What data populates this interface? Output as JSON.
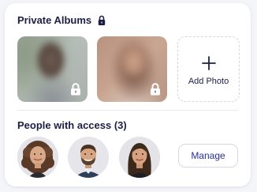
{
  "private_albums": {
    "title": "Private Albums",
    "title_icon": "lock-icon",
    "photos": [
      {
        "locked": true,
        "lock_icon": "lock-icon"
      },
      {
        "locked": true,
        "lock_icon": "lock-icon"
      }
    ],
    "add_photo": {
      "label": "Add Photo",
      "icon": "plus-icon"
    }
  },
  "people": {
    "title": "People with access (3)",
    "avatars": [
      "avatar-woman-curly-hair",
      "avatar-man-beard",
      "avatar-woman-long-hair"
    ],
    "manage_label": "Manage"
  },
  "colors": {
    "heading": "#1d1e45",
    "accent": "#2a2f9a",
    "border": "#d6d7e3",
    "background": "#f4f5f9"
  }
}
